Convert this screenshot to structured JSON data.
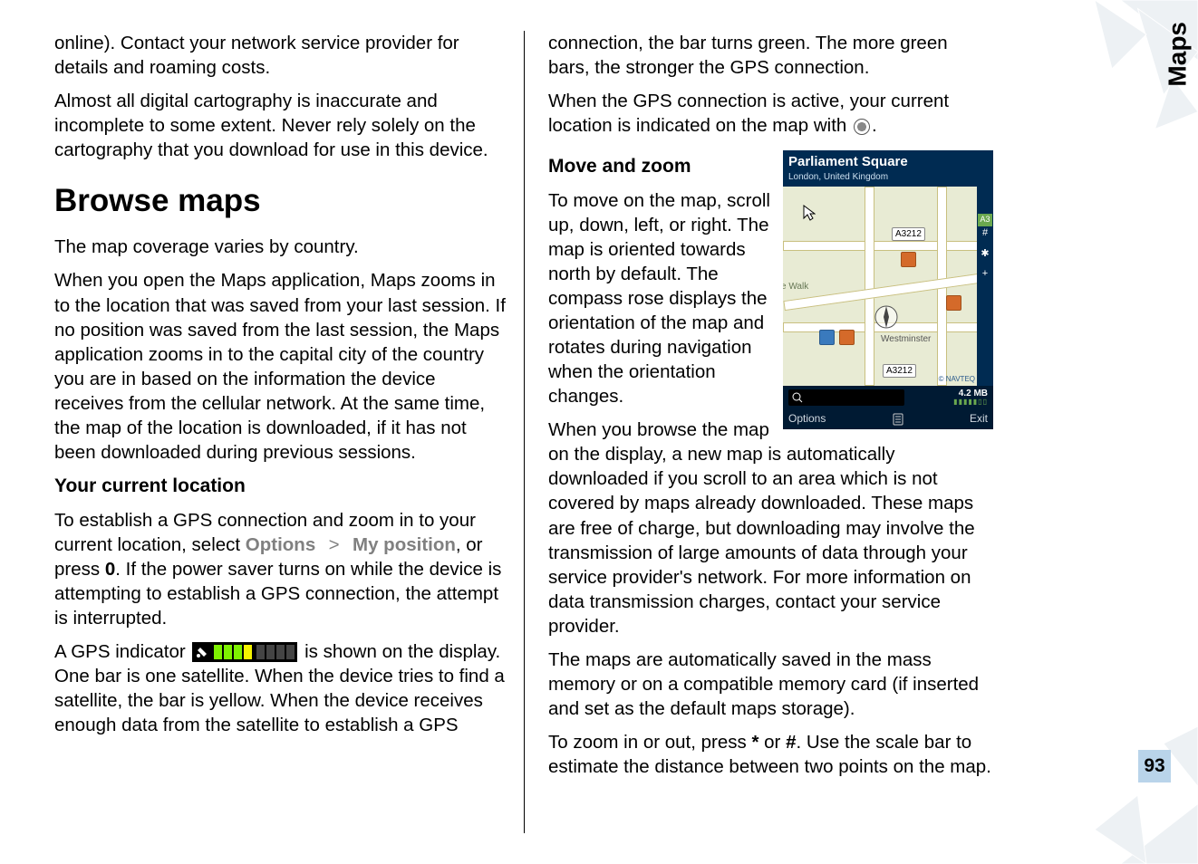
{
  "side_tab": "Maps",
  "page_number": "93",
  "left": {
    "p1": "online). Contact your network service provider for details and roaming costs.",
    "p2": "Almost all digital cartography is inaccurate and incomplete to some extent. Never rely solely on the cartography that you download for use in this device.",
    "h2": "Browse maps",
    "p3": "The map coverage varies by country.",
    "p4": "When you open the Maps application, Maps zooms in to the location that was saved from your last session. If no position was saved from the last session, the Maps application zooms in to the capital city of the country you are in based on the information the device receives from the cellular network. At the same time, the map of the location is downloaded, if it has not been downloaded during previous sessions.",
    "h3a": "Your current location",
    "p5a": "To establish a GPS connection and zoom in to your current location, select ",
    "menu_options": "Options",
    "menu_sep": ">",
    "menu_mypos": "My position",
    "p5b": ", or press ",
    "key_zero": "0",
    "p5c": ". If the power saver turns on while the device is attempting to establish a GPS connection, the attempt is interrupted.",
    "p6a": "A GPS indicator ",
    "p6b": " is shown on the display. One bar is one satellite. When the device tries to find a satellite, the bar is yellow. When the device receives enough data from the satellite to establish a GPS"
  },
  "right": {
    "p1": "connection, the bar turns green. The more green bars, the stronger the GPS connection.",
    "p2a": "When the GPS connection is active, your current location is indicated on the map with ",
    "p2b": ".",
    "h3": "Move and zoom",
    "p3": "To move on the map, scroll up, down, left, or right. The map is oriented towards north by default. The compass rose displays the orientation of the map and rotates during navigation when the orientation changes.",
    "p4": "When you browse the map on the display, a new map is automatically downloaded if you scroll to an area which is not covered by maps already downloaded. These maps are free of charge, but downloading may involve the transmission of large amounts of data through your service provider's network. For more information on data transmission charges, contact your service provider.",
    "p5": "The maps are automatically saved in the mass memory or on a compatible memory card (if inserted and set as the default maps storage).",
    "p6a": "To zoom in or out, press ",
    "key_star": "*",
    "p6_or": " or ",
    "key_hash": "#",
    "p6b": ". Use the scale bar to estimate the distance between two points on the map."
  },
  "map": {
    "title": "Parliament Square",
    "subtitle": "London, United Kingdom",
    "road_a": "A3212",
    "road_b": "A3212",
    "right_badge": "A3",
    "walk": "e Walk",
    "place": "Westminster",
    "copyright": "© NAVTEQ",
    "size": "4.2 MB",
    "left_softkey": "Options",
    "right_softkey": "Exit"
  }
}
